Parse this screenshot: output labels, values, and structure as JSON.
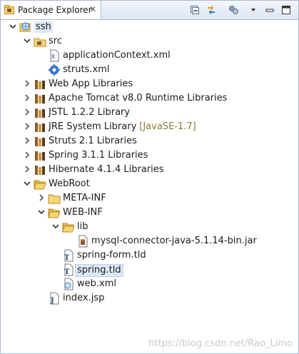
{
  "tab": {
    "title": "Package Explorer",
    "close_glyph": "✕",
    "icon": "package-explorer-icon"
  },
  "toolbar": {
    "collapse_all": "collapse-all-icon",
    "link_editor": "link-with-editor-icon",
    "focus": "focus-icon",
    "view_menu": "view-menu-icon",
    "minimize": "minimize-icon",
    "maximize": "maximize-icon"
  },
  "tree": {
    "project": {
      "label": "ssh",
      "expanded": true
    },
    "src": {
      "label": "src",
      "expanded": true
    },
    "src_children": [
      {
        "label": "applicationContext.xml",
        "icon": "xml-file-icon"
      },
      {
        "label": "struts.xml",
        "icon": "struts-config-icon"
      }
    ],
    "libraries": [
      {
        "label": "Web App Libraries",
        "suffix": ""
      },
      {
        "label": "Apache Tomcat v8.0 Runtime Libraries",
        "suffix": ""
      },
      {
        "label": "JSTL 1.2.2 Library",
        "suffix": ""
      },
      {
        "label": "JRE System Library",
        "suffix": "[JavaSE-1.7]"
      },
      {
        "label": "Struts 2.1 Libraries",
        "suffix": ""
      },
      {
        "label": "Spring 3.1.1 Libraries",
        "suffix": ""
      },
      {
        "label": "Hibernate 4.1.4 Libraries",
        "suffix": ""
      }
    ],
    "webroot": {
      "label": "WebRoot",
      "expanded": true
    },
    "meta_inf": {
      "label": "META-INF",
      "expanded": false
    },
    "web_inf": {
      "label": "WEB-INF",
      "expanded": true
    },
    "lib": {
      "label": "lib",
      "expanded": true
    },
    "jar": {
      "label": "mysql-connector-java-5.1.14-bin.jar"
    },
    "web_inf_files": [
      {
        "label": "spring-form.tld",
        "selected": false
      },
      {
        "label": "spring.tld",
        "selected": true
      },
      {
        "label": "web.xml",
        "selected": false
      }
    ],
    "index": {
      "label": "index.jsp"
    }
  },
  "watermark": "https://blog.csdn.net/Rao_Limo"
}
